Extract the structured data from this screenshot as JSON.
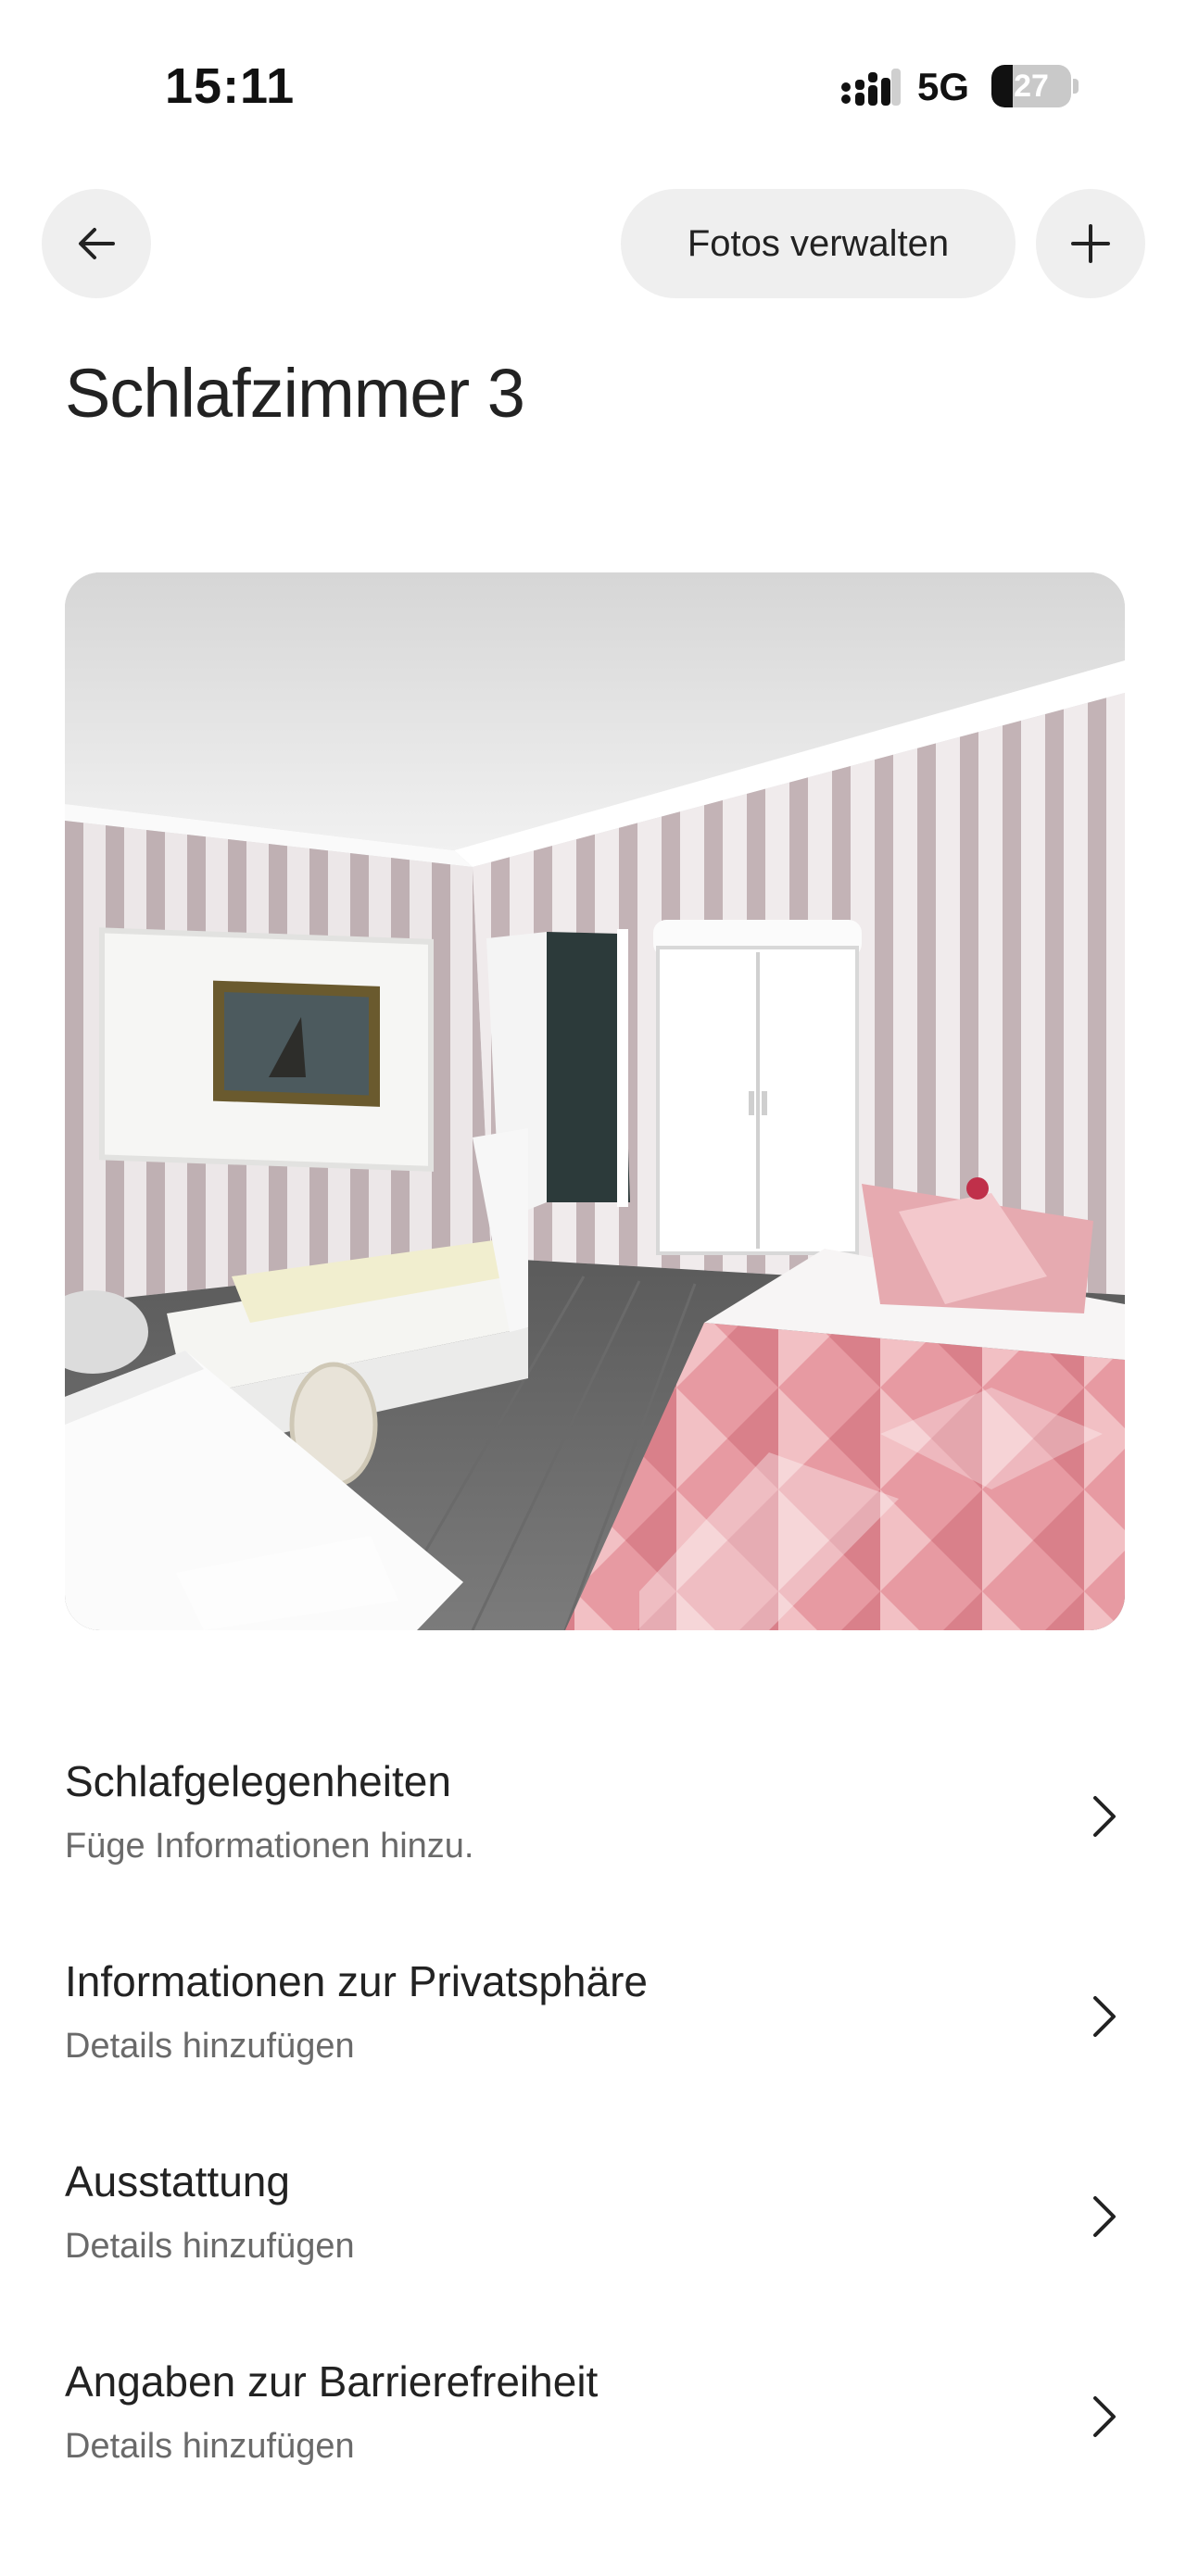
{
  "status_bar": {
    "time": "15:11",
    "network": "5G",
    "battery_level": "27",
    "battery_fraction": 0.27,
    "signal_icon": "signal-bars-icon"
  },
  "nav": {
    "back_icon": "arrow-left-icon",
    "manage_photos_label": "Fotos verwalten",
    "add_icon": "plus-icon"
  },
  "page": {
    "title": "Schlafzimmer 3"
  },
  "photo": {
    "description_icon": "room-photo"
  },
  "list": {
    "items": [
      {
        "title": "Schlafgelegenheiten",
        "subtitle": "Füge Informationen hinzu."
      },
      {
        "title": "Informationen zur Privatsphäre",
        "subtitle": "Details hinzufügen"
      },
      {
        "title": "Ausstattung",
        "subtitle": "Details hinzufügen"
      },
      {
        "title": "Angaben zur Barrierefreiheit",
        "subtitle": "Details hinzufügen"
      }
    ]
  },
  "colors": {
    "button_bg": "#efefef",
    "text_primary": "#222222",
    "text_secondary": "#6a6a6a"
  }
}
